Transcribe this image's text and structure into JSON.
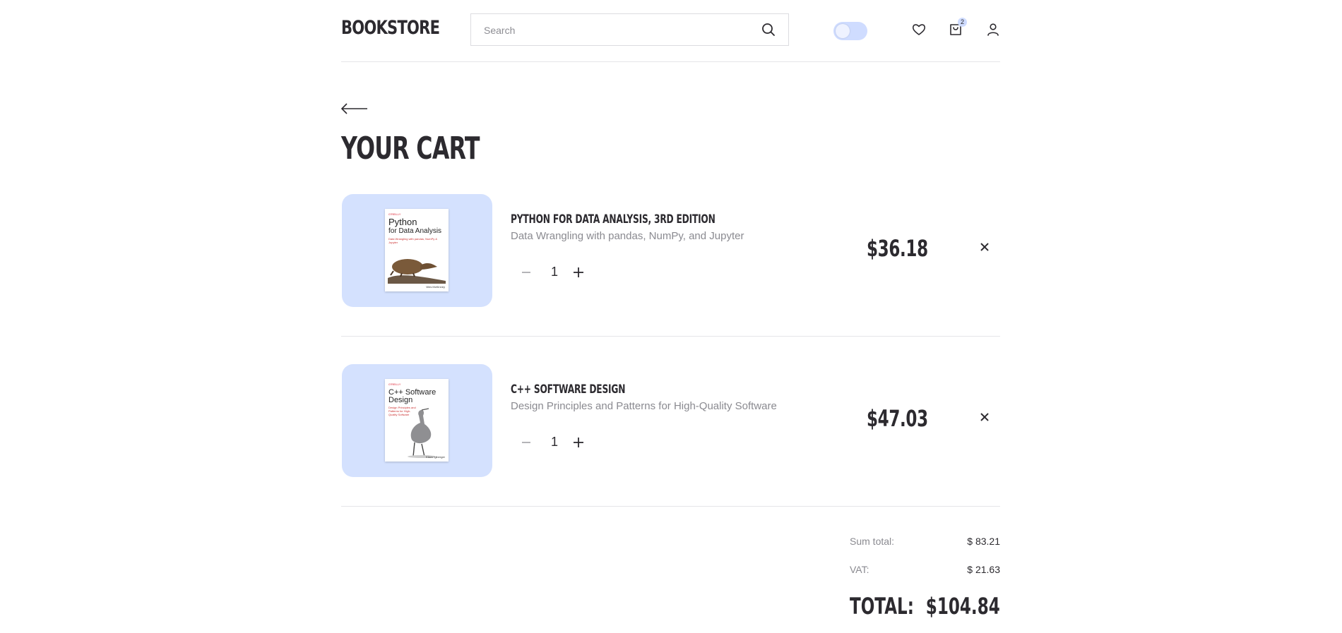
{
  "header": {
    "logo": "BOOKSTORE",
    "search_placeholder": "Search",
    "cart_count": "2"
  },
  "back_label": "back",
  "page_title": "YOUR CART",
  "items": [
    {
      "title": "PYTHON FOR DATA ANALYSIS, 3RD EDITION",
      "subtitle": "Data Wrangling with pandas, NumPy, and Jupyter",
      "quantity": "1",
      "price": "$36.18",
      "cover": {
        "publisher": "O'REILLY",
        "line1": "Python",
        "line2": "for Data Analysis",
        "tagline": "Data Wrangling with pandas, NumPy & Jupyter",
        "author": "Wes McKinney"
      }
    },
    {
      "title": "C++ SOFTWARE DESIGN",
      "subtitle": "Design Principles and Patterns for High-Quality Software",
      "quantity": "1",
      "price": "$47.03",
      "cover": {
        "publisher": "O'REILLY",
        "line1": "C++ Software",
        "line2": "Design",
        "tagline": "Design Principles and Patterns for High-Quality Software",
        "author": "Klaus Iglberger"
      }
    }
  ],
  "summary": {
    "sum_total_label": "Sum total:",
    "sum_total_value": "$ 83.21",
    "vat_label": "VAT:",
    "vat_value": "$ 21.63",
    "total_label": "TOTAL:",
    "total_value": "$104.84"
  },
  "colors": {
    "accent": "#d4e1fe",
    "text": "#2c2a2f",
    "muted": "#8a8a90"
  }
}
